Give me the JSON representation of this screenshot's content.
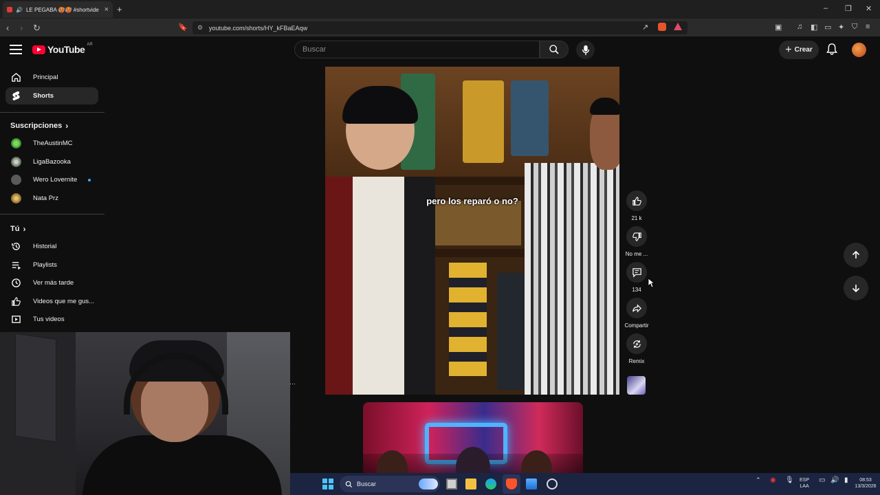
{
  "browser": {
    "tab_title": "LE PEGABA 🥵🥵 #shortvide",
    "url": "youtube.com/shorts/HY_kFBaEAqw",
    "new_tab_icon": "plus-icon"
  },
  "header": {
    "logo_text": "YouTube",
    "country_code": "AR",
    "search_placeholder": "Buscar",
    "create_label": "Crear"
  },
  "sidebar": {
    "main": [
      {
        "label": "Principal",
        "icon": "home-icon"
      },
      {
        "label": "Shorts",
        "icon": "shorts-icon",
        "active": true
      }
    ],
    "subscriptions_title": "Suscripciones",
    "subscriptions": [
      {
        "label": "TheAustinMC",
        "color": "#2e7d32"
      },
      {
        "label": "LigaBazooka",
        "color": "#6f7f6a"
      },
      {
        "label": "Wero Lovernite",
        "color": "#555555",
        "new": true
      },
      {
        "label": "Nata Prz",
        "color": "#b08a3a"
      }
    ],
    "you_title": "Tú",
    "you": [
      {
        "label": "Historial",
        "icon": "history-icon"
      },
      {
        "label": "Playlists",
        "icon": "playlist-icon"
      },
      {
        "label": "Ver más tarde",
        "icon": "clock-icon"
      },
      {
        "label": "Videos que me gus...",
        "icon": "thumbs-up-icon"
      },
      {
        "label": "Tus videos",
        "icon": "video-icon"
      }
    ]
  },
  "short": {
    "caption": "pero los reparó o no?",
    "likes": "21 k",
    "dislike_label": "No me ...",
    "comments": "134",
    "share_label": "Compartir",
    "remix_label": "Remix"
  },
  "taskbar": {
    "search_label": "Buscar",
    "lang_top": "ESP",
    "lang_bottom": "LAA",
    "time": "08:53",
    "date": "13/3/2026"
  },
  "colors": {
    "bg": "#0f0f0f",
    "accent_red": "#ff0033",
    "chip": "#272727"
  }
}
